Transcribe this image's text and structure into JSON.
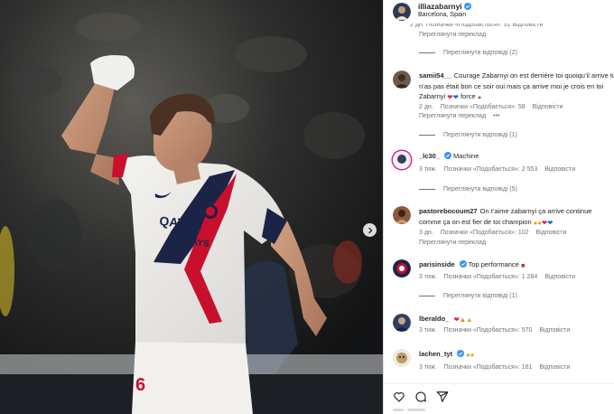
{
  "header": {
    "username": "illiazabarnyi",
    "location": "Barcelona, Spain"
  },
  "top_partial": {
    "meta": "2 дн.   Позначки «Подобається»: 31   Відповісти",
    "translate": "Переглянути переклад",
    "replies": "Переглянути відповіді (2)"
  },
  "comments": [
    {
      "username": "samii54__",
      "text": "Courage Zabarnyi on est derrière toi quoiqu’il arrive tu n’as pas était bon ce soir oui mais ça arrive moi je crois en toi Zabarnyi",
      "emoji_tail": "force",
      "time": "2 дн.",
      "likes": "Позначки «Подобається»: 58",
      "reply": "Відповісти",
      "translate": "Переглянути переклад",
      "more": "•••",
      "replies": "Переглянути відповіді (1)"
    },
    {
      "username": "_lc30_",
      "text": "Machine",
      "time": "3 тиж.",
      "likes": "Позначки «Подобається»: 2 553",
      "reply": "Відповісти",
      "replies": "Переглянути відповіді (5)"
    },
    {
      "username": "pastorebocoum27",
      "text": "On t’aime zabarnyi ça arrive continue comme ça on est fier de toi champion",
      "time": "3 дн.",
      "likes": "Позначки «Подобається»: 102",
      "reply": "Відповісти",
      "translate": "Переглянути переклад"
    },
    {
      "username": "parisinside",
      "text": "Top performance",
      "time": "3 тиж.",
      "likes": "Позначки «Подобається»: 1 284",
      "reply": "Відповісти",
      "replies": "Переглянути відповіді (1)"
    },
    {
      "username": "lberaldo_",
      "text": "",
      "time": "3 тиж.",
      "likes": "Позначки «Подобається»: 570",
      "reply": "Відповісти"
    },
    {
      "username": "lachen_tyt",
      "text": "",
      "time": "3 тиж.",
      "likes": "Позначки «Подобається»: 161",
      "reply": "Відповісти"
    }
  ],
  "photo": {
    "sponsor_line1": "QATAR",
    "sponsor_line2": "AIRWAYS",
    "shirt_number": "6"
  },
  "icons": {
    "verified": "verified-badge-icon",
    "heart": "heart-icon",
    "comment": "comment-icon",
    "share": "share-icon",
    "next": "chevron-right-icon"
  },
  "colors": {
    "verified_blue": "#3897f0",
    "meta_gray": "#737373",
    "psg_red": "#c8102e",
    "psg_navy": "#1b2346"
  }
}
